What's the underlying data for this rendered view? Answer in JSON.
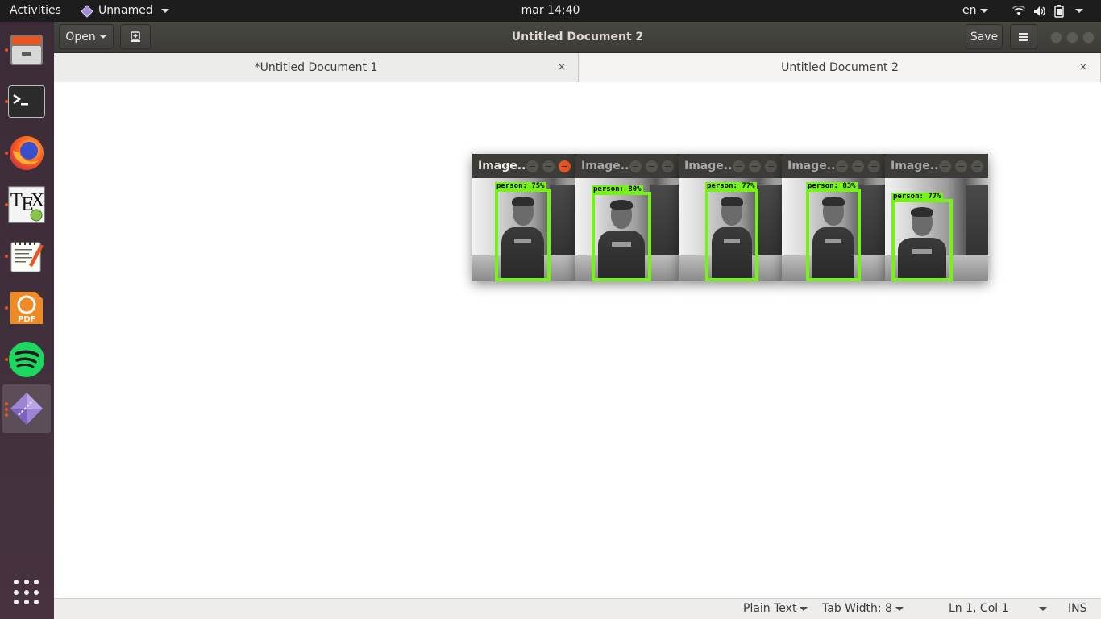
{
  "topbar": {
    "activities": "Activities",
    "app_menu": "Unnamed",
    "clock": "mar 14:40",
    "language": "en",
    "icons": [
      "wifi-icon",
      "volume-icon",
      "battery-icon",
      "power-caret-icon"
    ]
  },
  "dock": {
    "items": [
      {
        "name": "files",
        "icon": "file-cabinet-icon"
      },
      {
        "name": "terminal",
        "icon": "terminal-icon"
      },
      {
        "name": "firefox",
        "icon": "firefox-icon"
      },
      {
        "name": "texmaker",
        "icon": "tex-icon",
        "text": "TEX"
      },
      {
        "name": "text-editor",
        "icon": "notepad-icon"
      },
      {
        "name": "foxit-pdf",
        "icon": "pdf-icon",
        "text": "PDF"
      },
      {
        "name": "spotify",
        "icon": "spotify-icon"
      },
      {
        "name": "unnamed-app",
        "icon": "purple-diamond-icon",
        "active": true
      }
    ]
  },
  "header": {
    "open_label": "Open",
    "title": "Untitled Document 2",
    "save_label": "Save"
  },
  "tabs": [
    {
      "label": "*Untitled Document 1",
      "close": "×"
    },
    {
      "label": "Untitled Document 2",
      "close": "×"
    }
  ],
  "image_windows": [
    {
      "title": "Image...",
      "label": "person: 75%",
      "confidence": 0.75,
      "focused": true
    },
    {
      "title": "Image...",
      "label": "person: 80%",
      "confidence": 0.8,
      "focused": false
    },
    {
      "title": "Image...",
      "label": "person: 77%",
      "confidence": 0.77,
      "focused": false
    },
    {
      "title": "Image...",
      "label": "person: 83%",
      "confidence": 0.83,
      "focused": false
    },
    {
      "title": "Image...",
      "label": "person: 77%",
      "confidence": 0.77,
      "focused": false
    }
  ],
  "statusbar": {
    "language": "Plain Text",
    "tab_width": "Tab Width: 8",
    "position": "Ln 1, Col 1",
    "mode": "INS"
  },
  "colors": {
    "accent": "#e95420",
    "bbox": "#76f21a",
    "header": "#3c3b37",
    "dock": "#3e2f3a"
  }
}
